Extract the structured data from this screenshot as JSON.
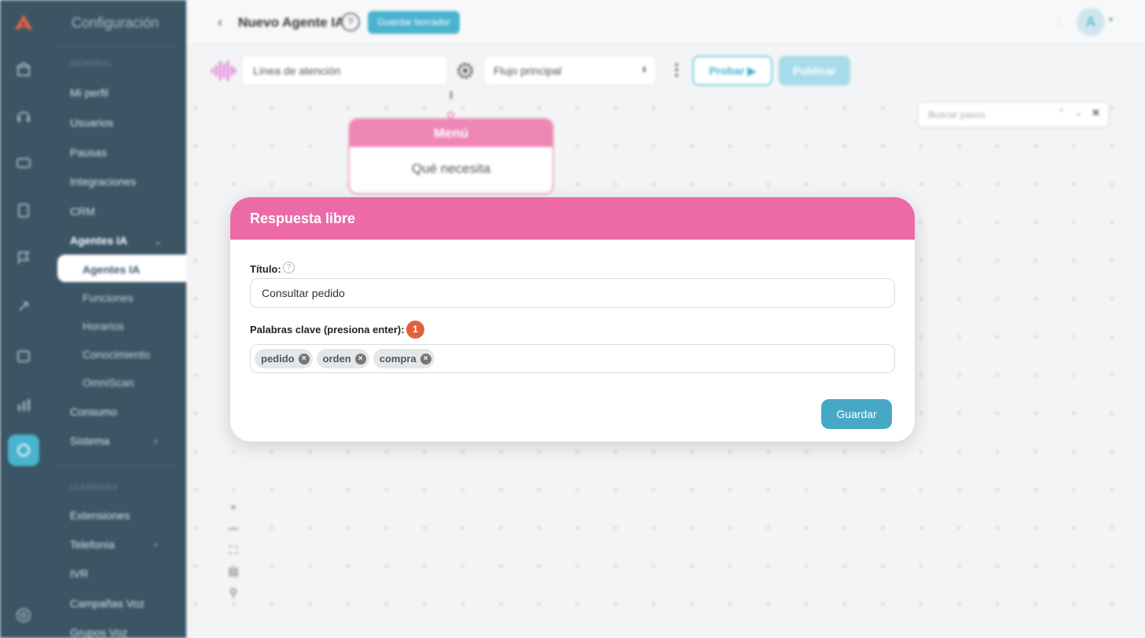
{
  "sidebar": {
    "title": "Configuración",
    "section_general": "GENERAL",
    "items": {
      "mi_perfil": "Mi perfil",
      "usuarios": "Usuarios",
      "pausas": "Pausas",
      "integraciones": "Integraciones",
      "crm": "CRM",
      "agentes_ia": "Agentes IA",
      "agentes_ia_sub": "Agentes IA",
      "funciones": "Funciones",
      "horarios": "Horarios",
      "conocimiento": "Conocimiento",
      "omniscan": "OmniScan",
      "consumo": "Consumo",
      "sistema": "Sistema"
    },
    "section_llamadas": "LLAMADAS",
    "items2": {
      "extensiones": "Extensiones",
      "telefonia": "Telefonía",
      "ivr": "IVR",
      "campanas_voz": "Campañas Voz",
      "grupos_voz": "Grupos Voz"
    }
  },
  "topbar": {
    "title": "Nuevo Agente IA",
    "help": "?",
    "draft_label": "Guardar borrador",
    "avatar_initial": "A"
  },
  "toolbar": {
    "line_value": "Línea de atención",
    "flow_value": "Flujo principal",
    "test_label": "Probar",
    "publish_label": "Publicar"
  },
  "canvas": {
    "search_placeholder": "Buscar pasos",
    "node": {
      "title": "Menú",
      "body": "Qué necesita"
    }
  },
  "modal": {
    "title": "Respuesta libre",
    "title_label": "Título:",
    "title_value": "Consultar pedido",
    "keywords_label": "Palabras clave (presiona enter):",
    "keywords_badge": "1",
    "tags": [
      "pedido",
      "orden",
      "compra"
    ],
    "save_label": "Guardar"
  },
  "colors": {
    "accent": "#4ab3cf",
    "modal_header": "#ec6aa8",
    "sidebar_bg": "#3b5565",
    "badge": "#e0623b"
  }
}
